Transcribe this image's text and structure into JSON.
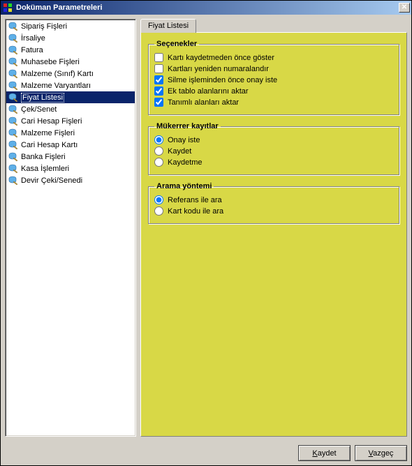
{
  "window": {
    "title": "Doküman Parametreleri"
  },
  "sidebar": {
    "items": [
      {
        "label": "Sipariş Fişleri"
      },
      {
        "label": "İrsaliye"
      },
      {
        "label": "Fatura"
      },
      {
        "label": "Muhasebe Fişleri"
      },
      {
        "label": "Malzeme (Sınıf) Kartı"
      },
      {
        "label": "Malzeme Varyantları"
      },
      {
        "label": "Fiyat Listesi",
        "selected": true
      },
      {
        "label": "Çek/Senet"
      },
      {
        "label": "Cari Hesap Fişleri"
      },
      {
        "label": "Malzeme Fişleri"
      },
      {
        "label": "Cari Hesap Kartı"
      },
      {
        "label": "Banka Fişleri"
      },
      {
        "label": "Kasa İşlemleri"
      },
      {
        "label": "Devir Çeki/Senedi"
      }
    ]
  },
  "tab": {
    "label": "Fiyat Listesi"
  },
  "groups": {
    "options": {
      "legend": "Seçenekler",
      "items": [
        {
          "label": "Kartı kaydetmeden önce göster",
          "checked": false
        },
        {
          "label": "Kartları yeniden numaralandır",
          "checked": false
        },
        {
          "label": "Silme işleminden önce onay iste",
          "checked": true
        },
        {
          "label": "Ek tablo alanlarını aktar",
          "checked": true
        },
        {
          "label": "Tanımlı alanları aktar",
          "checked": true
        }
      ]
    },
    "duplicates": {
      "legend": "Mükerrer kayıtlar",
      "items": [
        {
          "label": "Onay iste",
          "checked": true
        },
        {
          "label": "Kaydet",
          "checked": false
        },
        {
          "label": "Kaydetme",
          "checked": false
        }
      ]
    },
    "searchMethod": {
      "legend": "Arama yöntemi",
      "items": [
        {
          "label": "Referans ile ara",
          "checked": true
        },
        {
          "label": "Kart kodu ile ara",
          "checked": false
        }
      ]
    }
  },
  "buttons": {
    "save": "Kaydet",
    "cancel": "Vazgeç"
  }
}
